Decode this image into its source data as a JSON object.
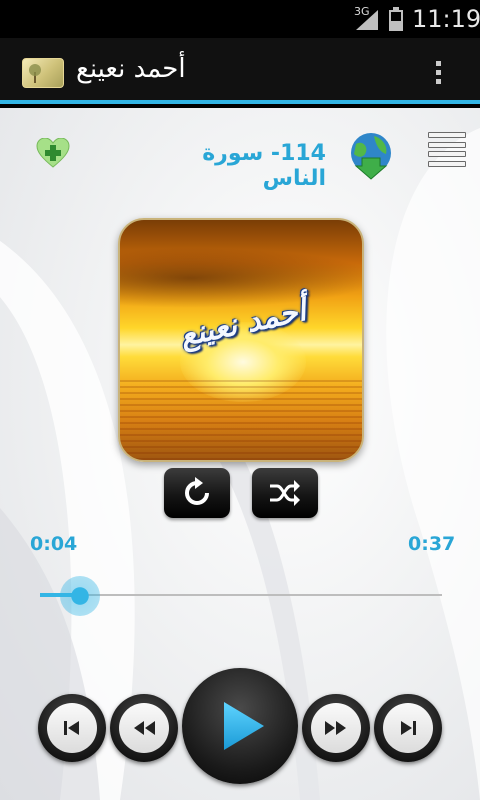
{
  "status_bar": {
    "network": "3G",
    "time": "11:19"
  },
  "action_bar": {
    "title": "أحمد نعينع",
    "app_icon": "tree-landscape-icon",
    "overflow_icon": "overflow-menu-icon"
  },
  "player": {
    "track_title": "114- سورة الناس",
    "cover_text": "أحمد نعينع",
    "favorite_icon": "heart-plus-icon",
    "download_icon": "globe-download-icon",
    "playlist_icon": "list-icon",
    "repeat_icon": "repeat-icon",
    "shuffle_icon": "shuffle-icon",
    "elapsed": "0:04",
    "duration": "0:37",
    "progress_fraction": 0.1,
    "accent_color": "#29a6d6",
    "controls": {
      "previous_icon": "skip-previous-icon",
      "rewind_icon": "rewind-icon",
      "play_icon": "play-icon",
      "fast_forward_icon": "fast-forward-icon",
      "next_icon": "skip-next-icon"
    }
  }
}
